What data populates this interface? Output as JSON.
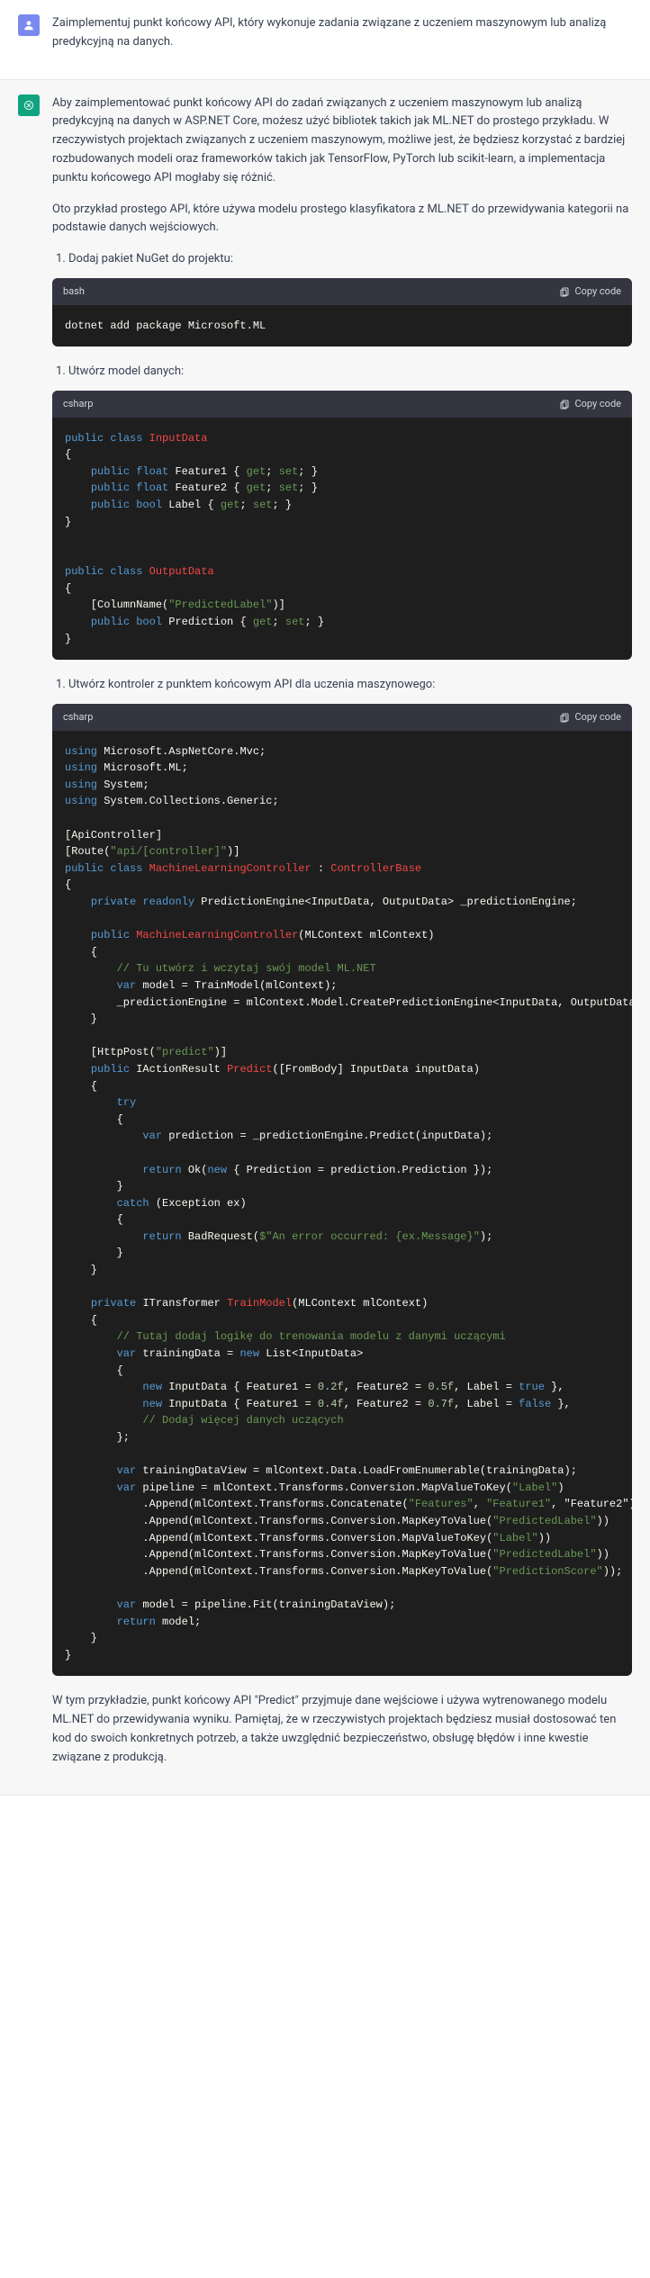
{
  "user_message": "Zaimplementuj punkt końcowy API, który wykonuje zadania związane z uczeniem maszynowym lub analizą predykcyjną na danych.",
  "assistant": {
    "intro_p1": "Aby zaimplementować punkt końcowy API do zadań związanych z uczeniem maszynowym lub analizą predykcyjną na danych w ASP.NET Core, możesz użyć bibliotek takich jak ML.NET do prostego przykładu. W rzeczywistych projektach związanych z uczeniem maszynowym, możliwe jest, że będziesz korzystać z bardziej rozbudowanych modeli oraz frameworków takich jak TensorFlow, PyTorch lub scikit-learn, a implementacja punktu końcowego API mogłaby się różnić.",
    "intro_p2": "Oto przykład prostego API, które używa modelu prostego klasyfikatora z ML.NET do przewidywania kategorii na podstawie danych wejściowych.",
    "step1": "Dodaj pakiet NuGet do projektu:",
    "step2": "Utwórz model danych:",
    "step3": "Utwórz kontroler z punktem końcowym API dla uczenia maszynowego:",
    "outro": "W tym przykładzie, punkt końcowy API \"Predict\" przyjmuje dane wejściowe i używa wytrenowanego modelu ML.NET do przewidywania wyniku. Pamiętaj, że w rzeczywistych projektach będziesz musiał dostosować ten kod do swoich konkretnych potrzeb, a także uwzględnić bezpieczeństwo, obsługę błędów i inne kwestie związane z produkcją."
  },
  "code_lang": {
    "bash": "bash",
    "csharp": "csharp"
  },
  "copy_label": "Copy code",
  "code1": "dotnet add package Microsoft.ML",
  "code2_tokens": {
    "public": "public",
    "class": "class",
    "InputData": "InputData",
    "float": "float",
    "Feature1": "Feature1",
    "Feature2": "Feature2",
    "get": "get",
    "set": "set",
    "bool": "bool",
    "Label": "Label",
    "OutputData": "OutputData",
    "ColumnName": "ColumnName",
    "PredictedLabel": "\"PredictedLabel\"",
    "Prediction": "Prediction"
  },
  "code3_tokens": {
    "using": "using",
    "ns1": "Microsoft.AspNetCore.Mvc",
    "ns2": "Microsoft.ML",
    "ns3": "System",
    "ns4": "System.Collections.Generic",
    "ApiController": "ApiController",
    "Route": "Route",
    "routeStr": "\"api/[controller]\"",
    "public": "public",
    "class": "class",
    "ctrlName": "MachineLearningController",
    "base": "ControllerBase",
    "private": "private",
    "readonly": "readonly",
    "predEngine": "PredictionEngine<InputData, OutputData>",
    "predField": "_predictionEngine",
    "ctor": "MachineLearningController",
    "ctorParam": "MLContext mlContext",
    "comment1": "// Tu utwórz i wczytaj swój model ML.NET",
    "var": "var",
    "model": "model",
    "TrainModel": "TrainModel",
    "assignPred": "_predictionEngine = mlContext.Model.CreatePredictionEngine<InputData, OutputData>(model);",
    "HttpPost": "HttpPost",
    "predictStr": "\"predict\"",
    "IActionResult": "IActionResult",
    "Predict": "Predict",
    "FromBody": "[FromBody]",
    "inputParam": "InputData inputData",
    "try": "try",
    "prediction": "prediction",
    "predCall": "_predictionEngine.Predict(inputData)",
    "return": "return",
    "Ok": "Ok",
    "new": "new",
    "PredProp": "Prediction",
    "predAccess": "prediction.Prediction",
    "catch": "catch",
    "ExParam": "Exception ex",
    "BadRequest": "BadRequest",
    "errStr": "$\"An error occurred: {ex.Message}\"",
    "ITransformer": "ITransformer",
    "TrainModelFn": "TrainModel",
    "trainParam": "MLContext mlContext",
    "comment2": "// Tutaj dodaj logikę do trenowania modelu z danymi uczącymi",
    "trainingData": "trainingData",
    "List": "List<InputData>",
    "InputData": "InputData",
    "f1a": "0.2f",
    "f2a": "0.5f",
    "true": "true",
    "f1b": "0.4f",
    "f2b": "0.7f",
    "false": "false",
    "comment3": "// Dodaj więcej danych uczących",
    "tdv": "trainingDataView",
    "loadEnum": "mlContext.Data.LoadFromEnumerable(trainingData)",
    "pipeline": "pipeline",
    "p1": "mlContext.Transforms.Conversion.MapValueToKey(",
    "k1": "\"Label\"",
    "p2": ".Append(mlContext.Transforms.Concatenate(",
    "feat": "\"Features\"",
    "f1": "\"Feature1\"",
    "p3": ".Append(mlContext.Transforms.Conversion.MapKeyToValue(",
    "pred1": "\"PredictedLabel\"",
    "p4": ".Append(mlContext.Transforms.Conversion.MapValueToKey(",
    "lbl2": "\"Label\"",
    "p5": ".Append(mlContext.Transforms.Conversion.MapKeyToValue(",
    "pred2": "\"PredictedLabel\"",
    "p6": ".Append(mlContext.Transforms.Conversion.MapKeyToValue(",
    "pred3": "\"PredictionScore\"",
    "fit": "pipeline.Fit(trainingDataView)",
    "retModel": "model"
  }
}
